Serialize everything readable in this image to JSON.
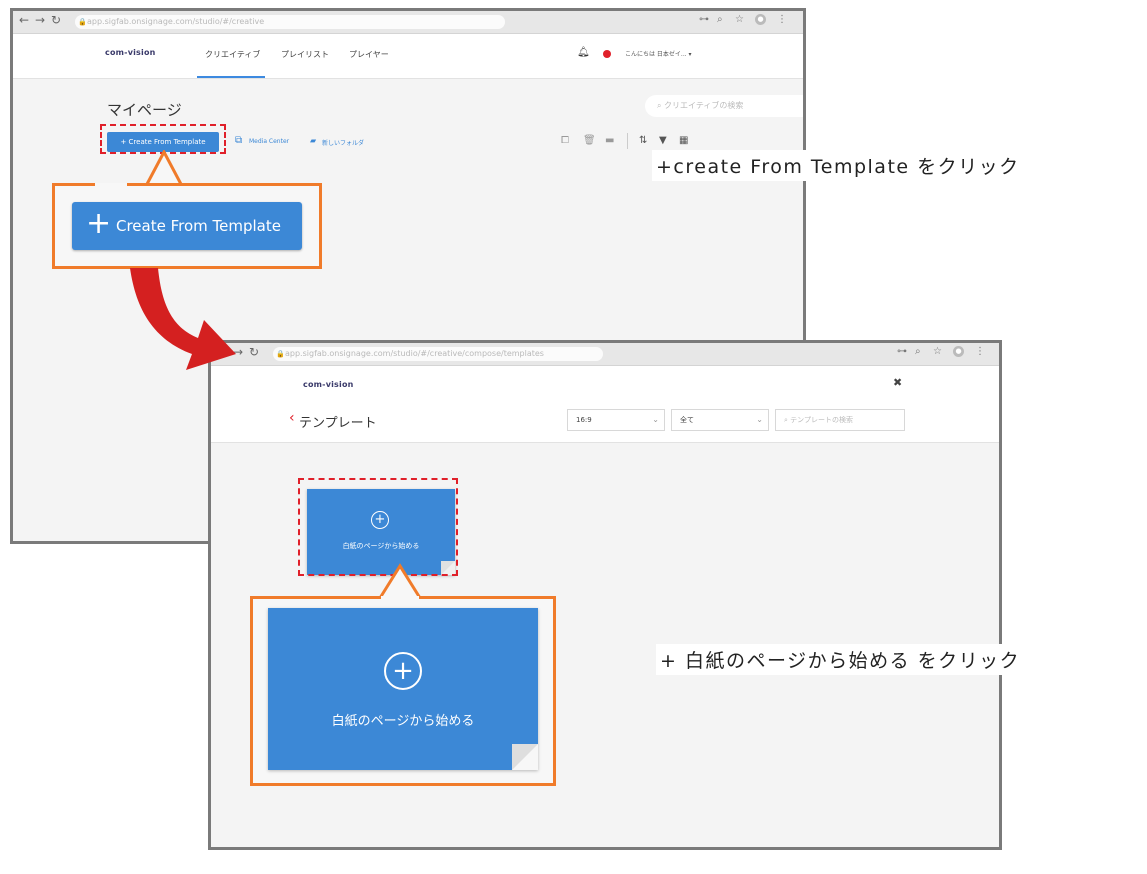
{
  "window1": {
    "url": "app.sigfab.onsignage.com/studio/#/creative",
    "logo": "com-vision",
    "nav_tabs": [
      "クリエイティブ",
      "プレイリスト",
      "プレイヤー"
    ],
    "user_greeting": "こんにちは 日本ゼイ... ▾",
    "page_title": "マイページ",
    "search_placeholder": "クリエイティブの検索",
    "create_button": "+ Create From Template",
    "media_center": "Media Center",
    "new_folder": "新しいフォルダ",
    "zoom_button_text": "Create From Template"
  },
  "window2": {
    "url": "app.sigfab.onsignage.com/studio/#/creative/compose/templates",
    "logo": "com-vision",
    "back_title": "テンプレート",
    "aspect_select": "16:9",
    "category_select": "全て",
    "search_placeholder": "テンプレートの検索",
    "blank_card_label": "白紙のページから始める",
    "blank_card_zoom_label": "白紙のページから始める"
  },
  "captions": {
    "step1": "+create From Template をクリック",
    "step2": "+ 白紙のページから始める をクリック"
  },
  "colors": {
    "accent_blue": "#3c88d6",
    "highlight_orange": "#f07b2a",
    "dashed_red": "#e0202a",
    "arrow_red": "#d42020"
  },
  "icons": {
    "browser_nav": [
      "back-icon",
      "forward-icon",
      "reload-icon"
    ],
    "header": [
      "bell-icon",
      "status-dot-icon"
    ],
    "toolbar": [
      "sort-icon",
      "filter-icon",
      "grid-view-icon"
    ]
  }
}
